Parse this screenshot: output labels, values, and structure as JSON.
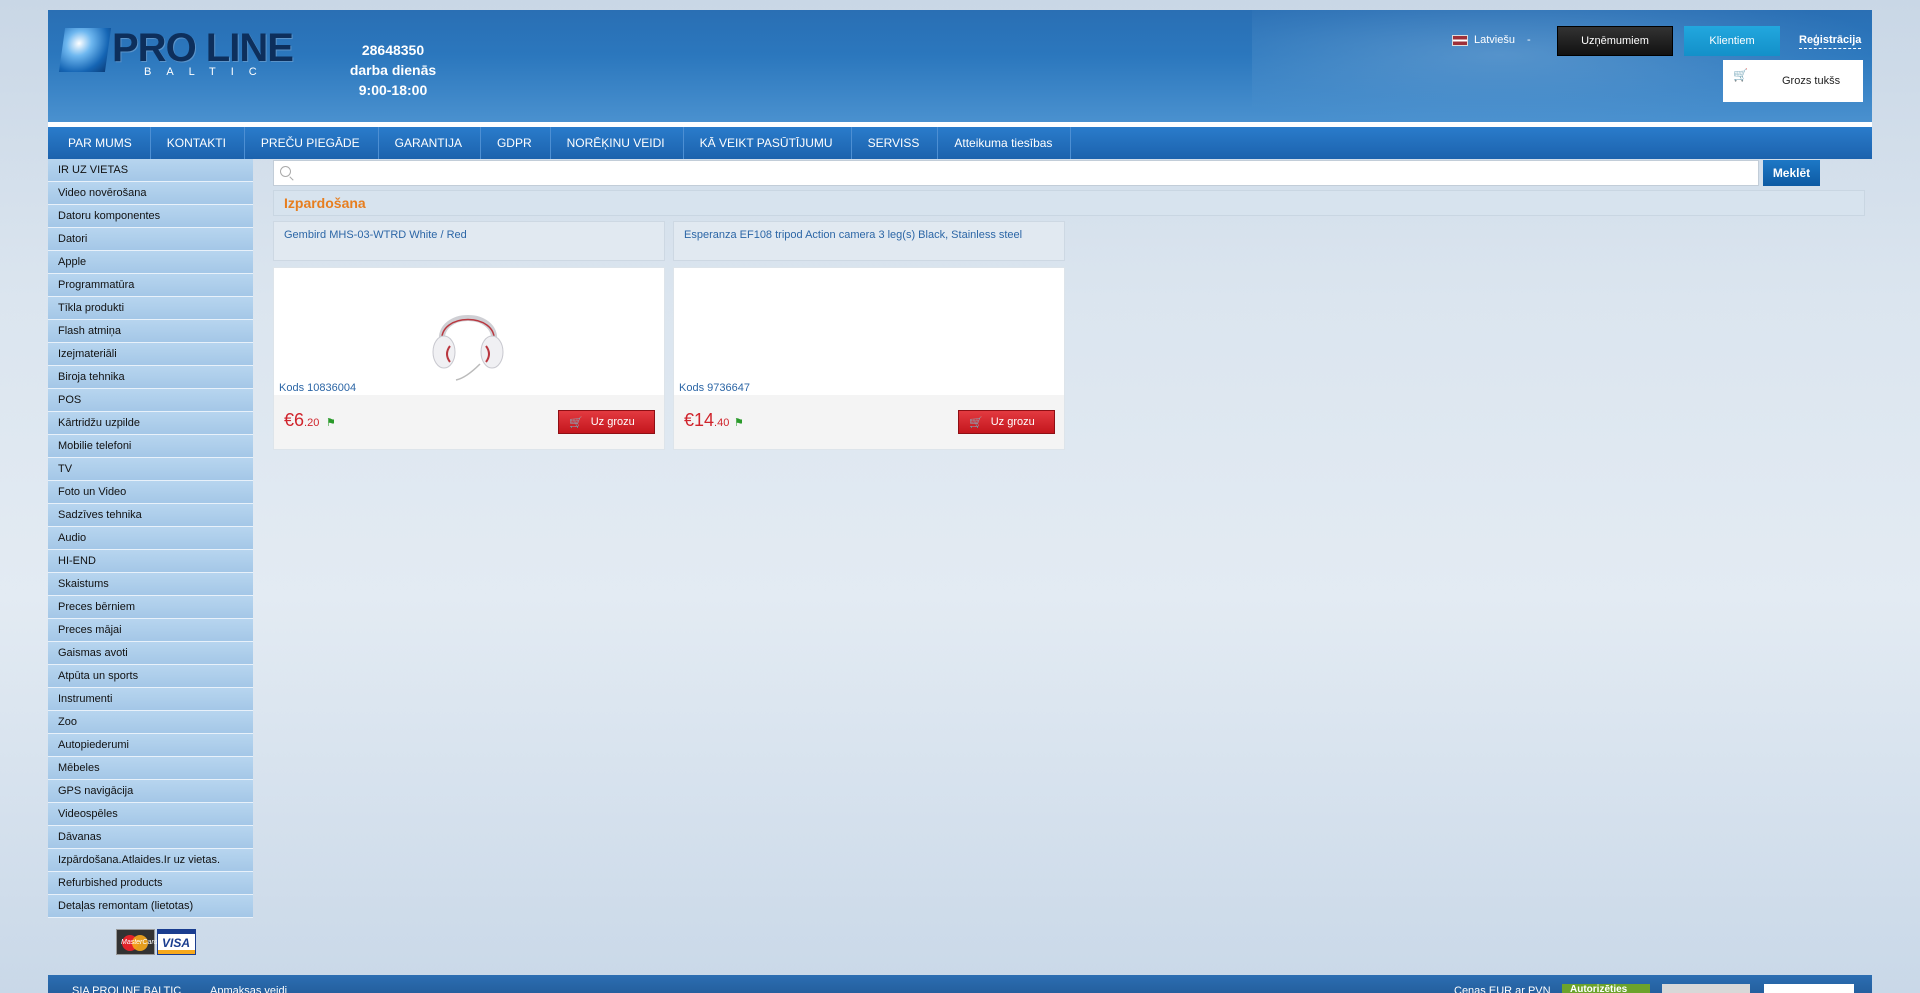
{
  "header": {
    "logo_text": "PRO LINE",
    "logo_sub": "BALTIC",
    "phone": "28648350",
    "hours_line1": "darba dienās",
    "hours_line2": "9:00-18:00",
    "language": "Latviešu",
    "btn_companies": "Uzņēmumiem",
    "btn_clients": "Klientiem",
    "register": "Reģistrācija",
    "cart": "Grozs tukšs"
  },
  "nav": [
    "PAR MUMS",
    "KONTAKTI",
    "PREČU PIEGĀDE",
    "GARANTIJA",
    "GDPR",
    "NORĒĶINU VEIDI",
    "KĀ VEIKT PASŪTĪJUMU",
    "SERVISS",
    "Atteikuma tiesības"
  ],
  "sidebar": [
    "IR UZ VIETAS",
    "Video novērošana",
    "Datoru komponentes",
    "Datori",
    "Apple",
    "Programmatūra",
    "Tīkla produkti",
    "Flash atmiņa",
    "Izejmateriāli",
    "Biroja tehnika",
    "POS",
    "Kārtridžu uzpilde",
    "Mobilie telefoni",
    "TV",
    "Foto un Video",
    "Sadzīves tehnika",
    "Audio",
    "HI-END",
    "Skaistums",
    "Preces bērniem",
    "Preces mājai",
    "Gaismas avoti",
    "Atpūta un sports",
    "Instrumenti",
    "Zoo",
    "Autopiederumi",
    "Mēbeles",
    "GPS navigācija",
    "Videospēles",
    "Dāvanas",
    "Izpārdošana.Atlaides.Ir uz vietas.",
    "Refurbished products",
    "Detaļas remontam (lietotas)"
  ],
  "search": {
    "placeholder": "",
    "button": "Meklēt"
  },
  "section_title": "Izpardošana",
  "products": [
    {
      "name": "Gembird MHS-03-WTRD White / Red",
      "code": "Kods 10836004",
      "price_main": "€6",
      "price_cents": ".20",
      "add_label": "Uz grozu",
      "has_image": true
    },
    {
      "name": "Esperanza EF108 tripod Action camera 3 leg(s) Black, Stainless steel",
      "code": "Kods 9736647",
      "price_main": "€14",
      "price_cents": ".40",
      "add_label": "Uz grozu",
      "has_image": false
    }
  ],
  "footer": {
    "company": "SIA PROLINE BALTIC",
    "payments": "Apmaksas veidi",
    "prices_note": "Cenas EUR ar PVN",
    "green_btn": "Autorizēties"
  },
  "colors": {
    "nav_blue": "#1c62ad",
    "accent_orange": "#e77e1f",
    "price_red": "#d0242c",
    "client_blue": "#1390c9"
  }
}
